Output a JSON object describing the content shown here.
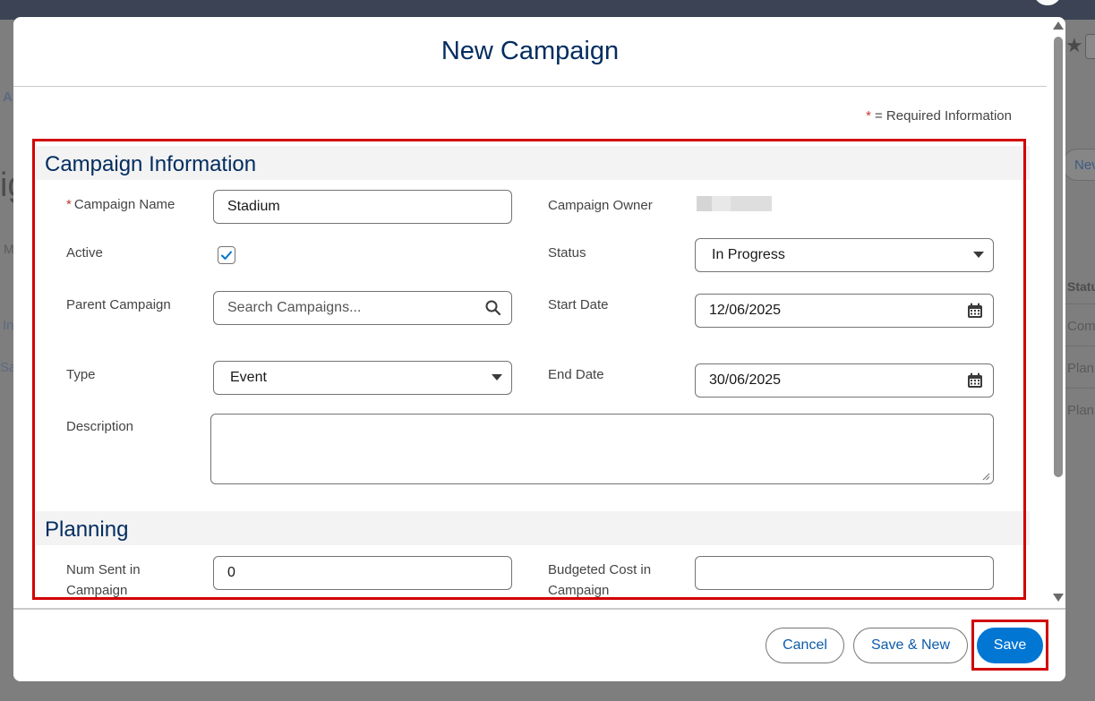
{
  "modal": {
    "title": "New Campaign",
    "required_info": "= Required Information",
    "required_star": "*"
  },
  "sections": {
    "campaign_information": "Campaign Information",
    "planning": "Planning"
  },
  "fields": {
    "campaign_name": {
      "label": "Campaign Name",
      "required_mark": "*",
      "value": "Stadium"
    },
    "campaign_owner": {
      "label": "Campaign Owner"
    },
    "active": {
      "label": "Active",
      "checked": true
    },
    "status": {
      "label": "Status",
      "value": "In Progress"
    },
    "parent_campaign": {
      "label": "Parent Campaign",
      "placeholder": "Search Campaigns..."
    },
    "start_date": {
      "label": "Start Date",
      "value": "12/06/2025"
    },
    "type": {
      "label": "Type",
      "value": "Event"
    },
    "end_date": {
      "label": "End Date",
      "value": "30/06/2025"
    },
    "description": {
      "label": "Description",
      "value": ""
    },
    "num_sent": {
      "label_line1": "Num Sent in",
      "label_line2": "Campaign",
      "value": "0"
    },
    "budgeted_cost": {
      "label_line1": "Budgeted Cost in",
      "label_line2": "Campaign",
      "value": ""
    }
  },
  "footer": {
    "cancel_label": "Cancel",
    "save_new_label": "Save & New",
    "save_label": "Save"
  },
  "background": {
    "frag_a": "A",
    "frag_ig": "ig",
    "frag_m": "M",
    "frag_in": "In",
    "frag_sa": "Sa",
    "new_button": "Nev",
    "col_status": "Statu",
    "row1_status": "Com",
    "row2_status": "Plan",
    "row3_status": "Plan"
  },
  "colors": {
    "brand": "#0176d3",
    "title": "#032d60",
    "highlight": "#d10000",
    "required": "#c23934"
  }
}
